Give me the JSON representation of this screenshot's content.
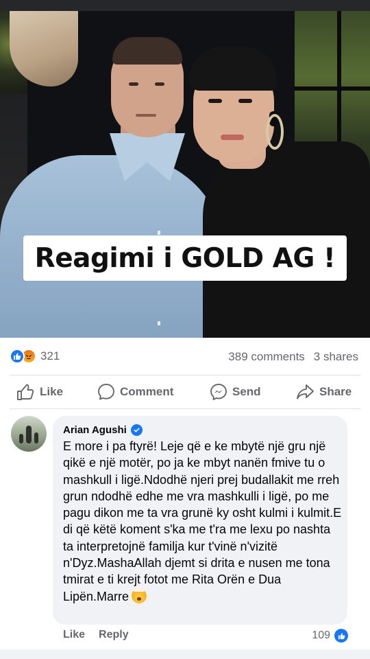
{
  "post": {
    "image_caption": "Reagimi i GOLD AG !"
  },
  "stats": {
    "reaction_count": "321",
    "reaction_types": [
      "like-icon",
      "angry-icon"
    ],
    "comments": "389 comments",
    "shares": "3 shares"
  },
  "actions": {
    "like": "Like",
    "comment": "Comment",
    "send": "Send",
    "share": "Share"
  },
  "comment": {
    "author": "Arian Agushi",
    "verified": true,
    "text": "E more i pa ftyrë! Leje që e ke mbytë një gru një qikë e një motër, po ja ke mbyt nanën fmive tu o mashkull i ligë.Ndodhë njeri prej budallakit me rreh grun ndodhë edhe me vra mashkulli i ligë, po me pagu dikon me ta vra grunë ky osht kulmi i kulmit.E di që këtë koment s'ka me t'ra me lexu po nashta ta interpretojnë familja kur t'vinë n'vizitë n'Dyz.MashaAllah djemt si drita e nusen me tona tmirat e ti krejt fotot me Rita Orën e Dua Lipën.Marre",
    "like_label": "Like",
    "reply_label": "Reply",
    "like_count": "109"
  },
  "colors": {
    "accent": "#1877f2",
    "muted_text": "#65676b",
    "bubble_bg": "#f0f2f5"
  }
}
